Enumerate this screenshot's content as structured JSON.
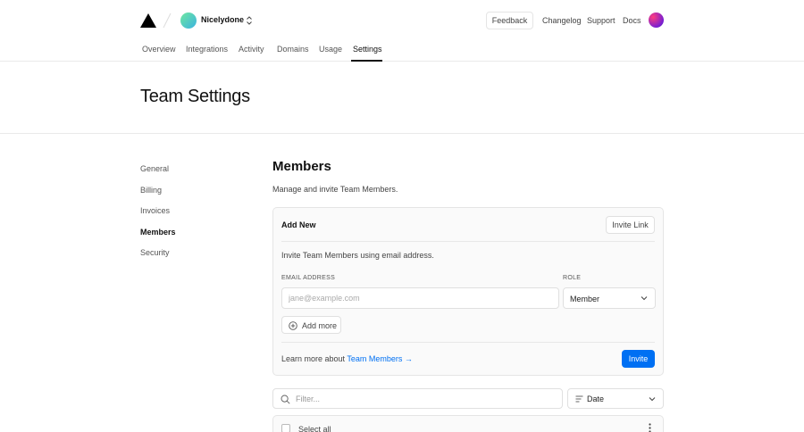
{
  "header": {
    "team_name": "Nicelydone",
    "feedback_label": "Feedback",
    "links": [
      "Changelog",
      "Support",
      "Docs"
    ]
  },
  "tabs": [
    "Overview",
    "Integrations",
    "Activity",
    "Domains",
    "Usage",
    "Settings"
  ],
  "active_tab": "Settings",
  "page_title": "Team Settings",
  "sidebar": {
    "items": [
      "General",
      "Billing",
      "Invoices",
      "Members",
      "Security"
    ],
    "active": "Members"
  },
  "members": {
    "title": "Members",
    "subtitle": "Manage and invite Team Members.",
    "add_new": {
      "title": "Add New",
      "invite_link_label": "Invite Link",
      "description": "Invite Team Members using email address.",
      "email_label": "EMAIL ADDRESS",
      "email_placeholder": "jane@example.com",
      "email_value": "",
      "role_label": "ROLE",
      "role_value": "Member",
      "add_more_label": "Add more",
      "learn_prefix": "Learn more about ",
      "learn_link": "Team Members →",
      "invite_label": "Invite"
    },
    "filter": {
      "placeholder": "Filter...",
      "sort_value": "Date"
    },
    "table": {
      "select_all_label": "Select all"
    }
  },
  "colors": {
    "accent": "#0070f3",
    "border": "#eaeaea"
  }
}
